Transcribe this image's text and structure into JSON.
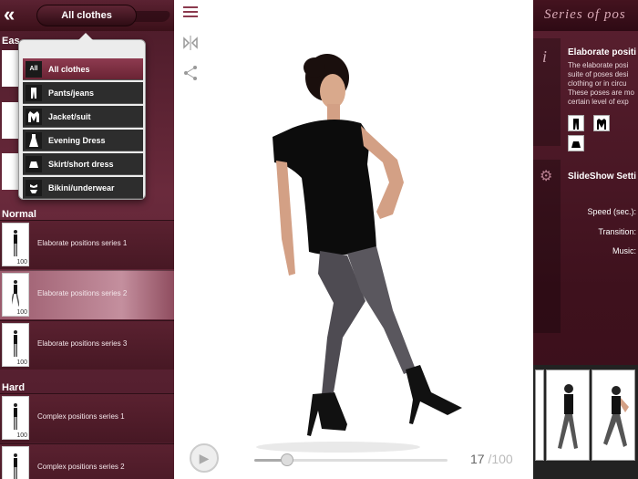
{
  "left": {
    "category_button": "All clothes",
    "sections": [
      {
        "label": "Eas"
      },
      {
        "label": "Normal"
      },
      {
        "label": "Hard"
      }
    ],
    "normal_items": [
      {
        "label": "Elaborate positions series 1",
        "count": "100"
      },
      {
        "label": "Elaborate positions series 2",
        "count": "100"
      },
      {
        "label": "Elaborate positions series 3",
        "count": "100"
      }
    ],
    "hard_items": [
      {
        "label": "Complex positions series 1",
        "count": "100"
      },
      {
        "label": "Complex positions series 2",
        "count": "100"
      }
    ]
  },
  "dropdown": {
    "options": [
      {
        "icon": "All",
        "label": "All clothes"
      },
      {
        "icon": "pants-icon",
        "label": "Pants/jeans"
      },
      {
        "icon": "jacket-icon",
        "label": "Jacket/suit"
      },
      {
        "icon": "dress-icon",
        "label": "Evening Dress"
      },
      {
        "icon": "skirt-icon",
        "label": "Skirt/short dress"
      },
      {
        "icon": "bikini-icon",
        "label": "Bikini/underwear"
      }
    ]
  },
  "center": {
    "current": "17",
    "total": "/100",
    "slider_progress": 0.17
  },
  "right": {
    "title": "Series of pos",
    "info_heading": "Elaborate positi",
    "info_desc": "The elaborate posi suite of poses desi clothing or in circu These poses are mo certain level of exp",
    "slideshow_heading": "SlideShow Setti",
    "speed_label": "Speed (sec.):",
    "transition_label": "Transition:",
    "music_label": "Music:"
  }
}
